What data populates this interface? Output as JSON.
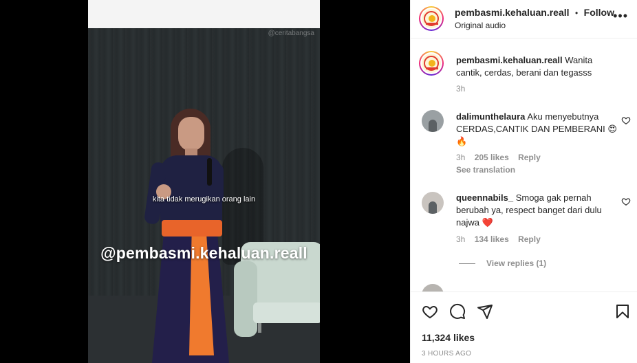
{
  "video": {
    "source_watermark": "@ceritabangsa",
    "subtitle": "kita tidak merugikan orang lain",
    "watermark": "@pembasmi.kehaluan.reall"
  },
  "header": {
    "username": "pembasmi.kehaluan.reall",
    "separator": "•",
    "follow_label": "Follow",
    "audio_label": "Original audio",
    "more_icon": "more-horizontal-icon"
  },
  "caption": {
    "username": "pembasmi.kehaluan.reall",
    "text": "Wanita cantik, cerdas, berani dan tegasss",
    "time": "3h"
  },
  "comments": [
    {
      "username": "dalimunthelaura",
      "text": "Aku menyebutnya CERDAS,CANTIK DAN PEMBERANI 😍🔥",
      "time": "3h",
      "likes": "205 likes",
      "reply_label": "Reply",
      "see_translation": "See translation"
    },
    {
      "username": "queennabils_",
      "text": "Smoga gak pernah berubah ya, respect banget dari dulu najwa ❤️",
      "time": "3h",
      "likes": "134 likes",
      "reply_label": "Reply",
      "view_replies": "View replies (1)"
    }
  ],
  "actions": {
    "like_icon": "heart-icon",
    "comment_icon": "comment-icon",
    "share_icon": "send-icon",
    "save_icon": "bookmark-icon",
    "likes_count": "11,324 likes",
    "posted_ago": "3 HOURS AGO"
  },
  "colors": {
    "text": "#262626",
    "secondary": "#8e8e8e",
    "border": "#efefef",
    "heart_red": "#ed4956"
  }
}
